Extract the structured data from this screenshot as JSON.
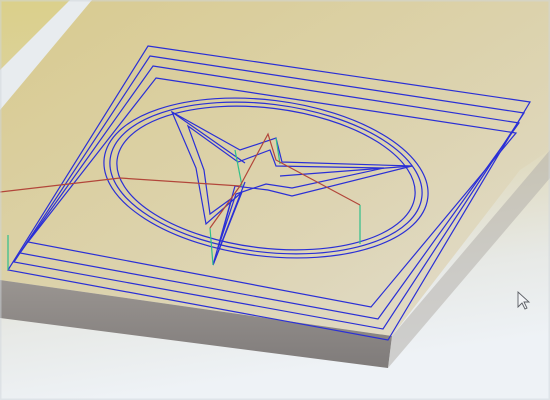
{
  "viewport": {
    "background_top": "#d9cf84",
    "background_mid": "#d8d1a6",
    "background_bottom": "#e6ecf1",
    "stock_face_color": "#ddd2a3",
    "stock_edge_color": "#8f8a88",
    "toolpath_color": "#2a2fd6",
    "rapid_move_color": "#b2463a",
    "plunge_color": "#2fbf8a",
    "cursor_icon": "mouse-pointer-arrow"
  },
  "toolpaths": {
    "pocket_boundary_passes": 4,
    "design": "circle-with-star"
  }
}
